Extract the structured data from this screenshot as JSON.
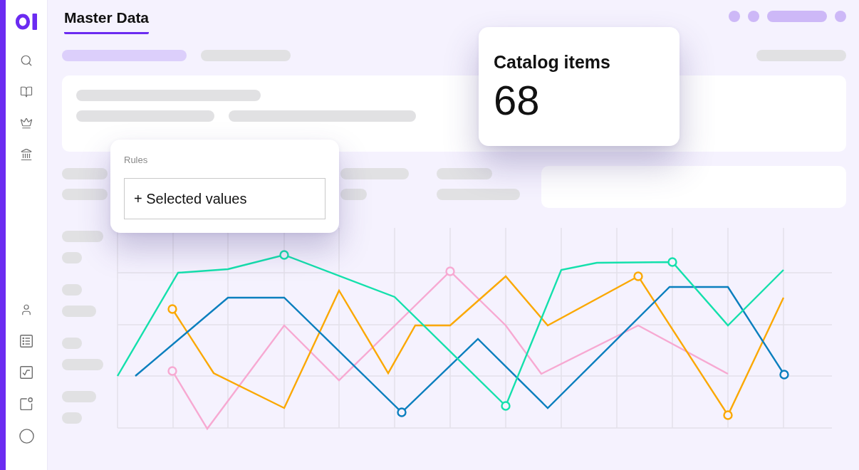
{
  "header": {
    "tabs": [
      {
        "label": "Master Data",
        "selected": true
      }
    ]
  },
  "rules_popover": {
    "label": "Rules",
    "add_button": "+ Selected values"
  },
  "stat_card": {
    "title": "Catalog items",
    "value": "68"
  }
}
